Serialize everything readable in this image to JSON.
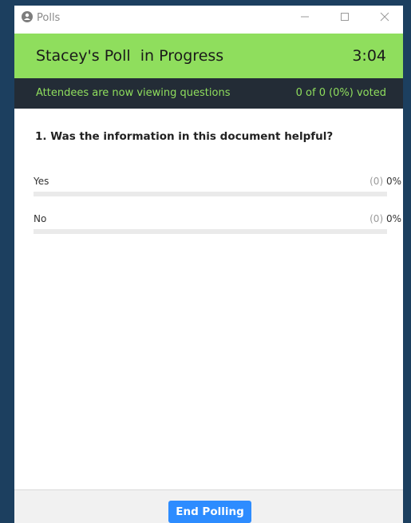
{
  "window": {
    "title": "Polls",
    "icon": "zoom-polls-icon",
    "controls": [
      "minimize-icon",
      "maximize-icon",
      "close-icon"
    ]
  },
  "header": {
    "title": "Stacey's Poll  in Progress",
    "timer": "3:04",
    "color": "#8fde5d"
  },
  "status": {
    "message": "Attendees are now viewing questions",
    "votes": "0 of 0 (0%) voted",
    "background": "#232c36"
  },
  "question": {
    "text": "1. Was the information in this document helpful?",
    "options": [
      {
        "label": "Yes",
        "count": "(0)",
        "percent": "0%",
        "fraction": 0
      },
      {
        "label": "No",
        "count": "(0)",
        "percent": "0%",
        "fraction": 0
      }
    ]
  },
  "footer": {
    "end_label": "End Polling",
    "button_color": "#2d8cff"
  }
}
